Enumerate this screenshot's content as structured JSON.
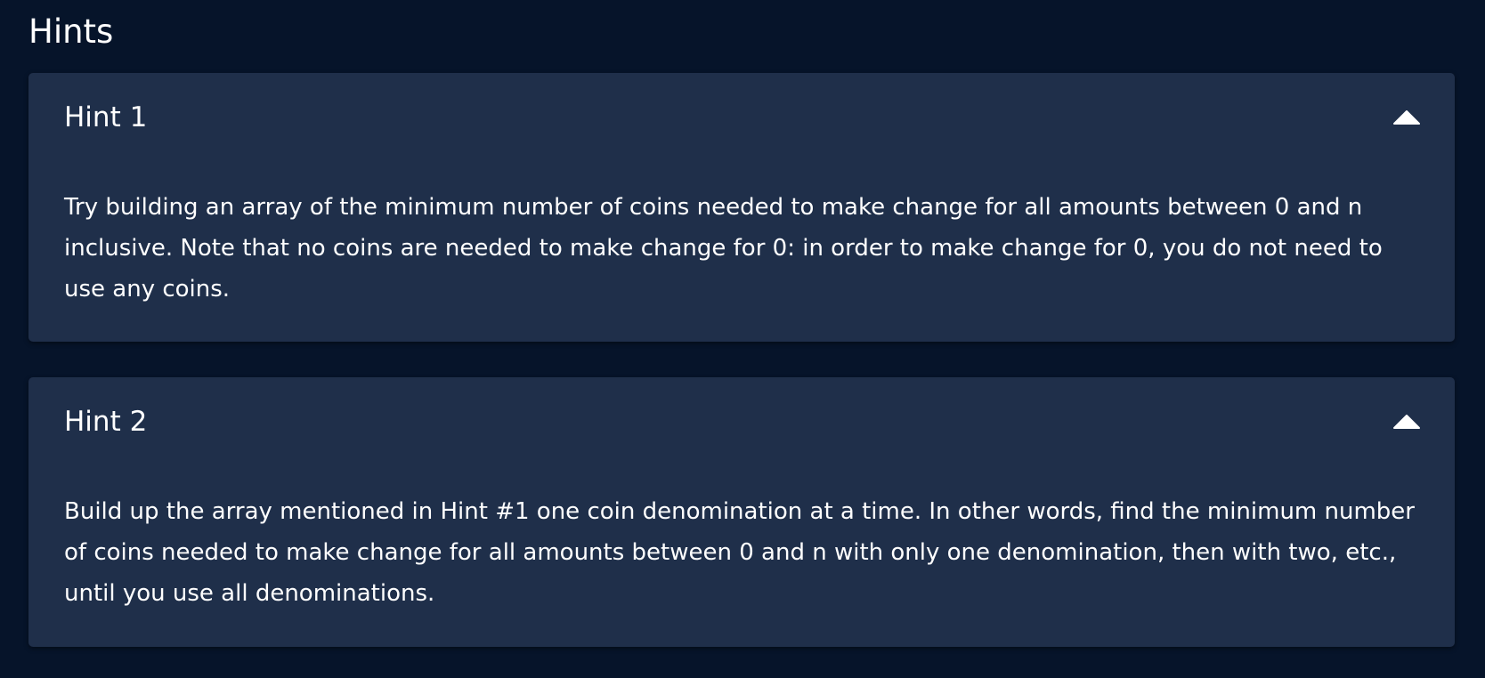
{
  "section": {
    "title": "Hints"
  },
  "hints": [
    {
      "label": "Hint 1",
      "expanded": true,
      "toggle_icon": "chevron-up-icon",
      "body": "Try building an array of the minimum number of coins needed to make change for all amounts between 0 and n inclusive. Note that no coins are needed to make change for 0: in order to make change for 0, you do not need to use any coins."
    },
    {
      "label": "Hint 2",
      "expanded": true,
      "toggle_icon": "chevron-up-icon",
      "body": "Build up the array mentioned in Hint #1 one coin denomination at a time. In other words, find the minimum number of coins needed to make change for all amounts between 0 and n with only one denomination, then with two, etc., until you use all denominations."
    }
  ],
  "colors": {
    "page_background": "#06142a",
    "card_background": "#1f2f4a",
    "text": "#ffffff"
  }
}
